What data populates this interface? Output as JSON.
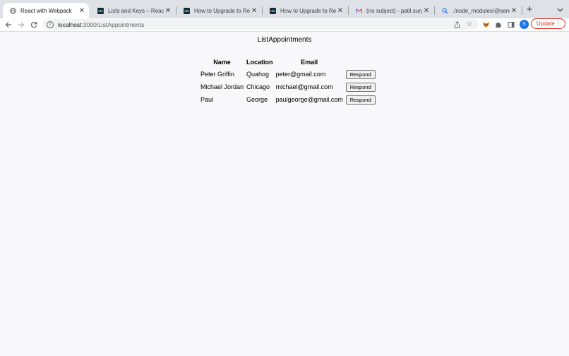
{
  "browser": {
    "tabs": [
      {
        "title": "React with Webpack",
        "icon": "globe-icon",
        "active": true
      },
      {
        "title": "Lists and Keys – React",
        "icon": "react-icon"
      },
      {
        "title": "How to Upgrade to React 1",
        "icon": "react-icon"
      },
      {
        "title": "How to Upgrade to React 1",
        "icon": "react-icon"
      },
      {
        "title": "(no subject) - patil.suryab",
        "icon": "gmail-icon"
      },
      {
        "title": "./node_modules/@sendgri",
        "icon": "search-icon"
      }
    ],
    "url_host": "localhost",
    "url_path": ":3000/ListAppointments",
    "avatar_initial": "S",
    "update_label": "Update",
    "accent": "#d93025"
  },
  "page": {
    "heading": "ListAppointments",
    "table": {
      "headers": [
        "Name",
        "Location",
        "Email"
      ],
      "rows": [
        {
          "name": "Peter Griffin",
          "location": "Quahog",
          "email": "peter@gmail.com",
          "action": "Respond"
        },
        {
          "name": "Michael Jordan",
          "location": "Chicago",
          "email": "michael@gmail.com",
          "action": "Respond"
        },
        {
          "name": "Paul",
          "location": "George",
          "email": "paulgeorge@gmail.com",
          "action": "Respond"
        }
      ]
    }
  }
}
